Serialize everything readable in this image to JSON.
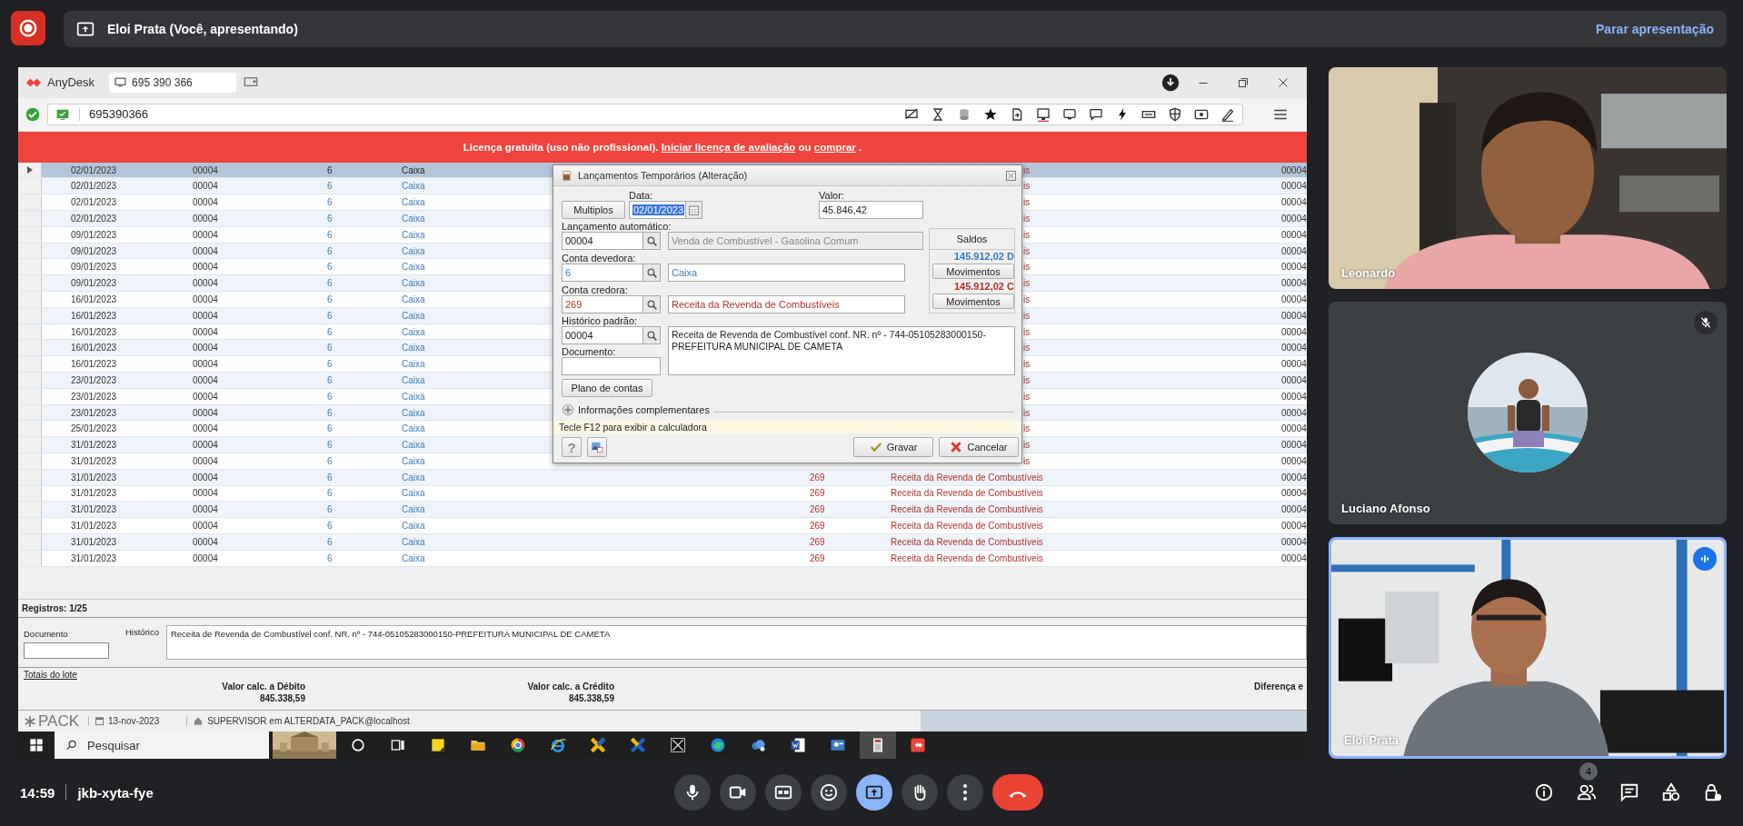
{
  "meet_top": {
    "presenting_label": "Eloi Prata (Você, apresentando)",
    "stop_button": "Parar apresentação"
  },
  "anydesk": {
    "app_name": "AnyDesk",
    "tab_label": "695 390 366",
    "address": "695390366",
    "banner": {
      "text": "Licença gratuita (uso não profissional).",
      "trial_link": "Iniciar licença de avaliação",
      "or": "ou",
      "buy_link": "comprar",
      "end": "."
    }
  },
  "table": {
    "rows": [
      {
        "selected": true,
        "date": "02/01/2023",
        "entry": "00004",
        "debit_code": "6",
        "debit_name": "Caixa",
        "credit_name": "is",
        "column_7": "00004"
      },
      {
        "selected": false,
        "date": "02/01/2023",
        "entry": "00004",
        "debit_code": "6",
        "debit_name": "Caixa",
        "credit_name": "is",
        "column_7": "00004"
      },
      {
        "selected": false,
        "date": "02/01/2023",
        "entry": "00004",
        "debit_code": "6",
        "debit_name": "Caixa",
        "credit_name": "is",
        "column_7": "00004"
      },
      {
        "selected": false,
        "date": "02/01/2023",
        "entry": "00004",
        "debit_code": "6",
        "debit_name": "Caixa",
        "credit_name": "is",
        "column_7": "00004"
      },
      {
        "selected": false,
        "date": "09/01/2023",
        "entry": "00004",
        "debit_code": "6",
        "debit_name": "Caixa",
        "credit_name": "is",
        "column_7": "00004"
      },
      {
        "selected": false,
        "date": "09/01/2023",
        "entry": "00004",
        "debit_code": "6",
        "debit_name": "Caixa",
        "credit_name": "is",
        "column_7": "00004"
      },
      {
        "selected": false,
        "date": "09/01/2023",
        "entry": "00004",
        "debit_code": "6",
        "debit_name": "Caixa",
        "credit_name": "is",
        "column_7": "00004"
      },
      {
        "selected": false,
        "date": "09/01/2023",
        "entry": "00004",
        "debit_code": "6",
        "debit_name": "Caixa",
        "credit_name": "is",
        "column_7": "00004"
      },
      {
        "selected": false,
        "date": "16/01/2023",
        "entry": "00004",
        "debit_code": "6",
        "debit_name": "Caixa",
        "credit_name": "is",
        "column_7": "00004"
      },
      {
        "selected": false,
        "date": "16/01/2023",
        "entry": "00004",
        "debit_code": "6",
        "debit_name": "Caixa",
        "credit_name": "is",
        "column_7": "00004"
      },
      {
        "selected": false,
        "date": "16/01/2023",
        "entry": "00004",
        "debit_code": "6",
        "debit_name": "Caixa",
        "credit_name": "is",
        "column_7": "00004"
      },
      {
        "selected": false,
        "date": "16/01/2023",
        "entry": "00004",
        "debit_code": "6",
        "debit_name": "Caixa",
        "credit_name": "is",
        "column_7": "00004"
      },
      {
        "selected": false,
        "date": "16/01/2023",
        "entry": "00004",
        "debit_code": "6",
        "debit_name": "Caixa",
        "credit_name": "is",
        "column_7": "00004"
      },
      {
        "selected": false,
        "date": "23/01/2023",
        "entry": "00004",
        "debit_code": "6",
        "debit_name": "Caixa",
        "credit_name": "is",
        "column_7": "00004"
      },
      {
        "selected": false,
        "date": "23/01/2023",
        "entry": "00004",
        "debit_code": "6",
        "debit_name": "Caixa",
        "credit_name": "is",
        "column_7": "00004"
      },
      {
        "selected": false,
        "date": "23/01/2023",
        "entry": "00004",
        "debit_code": "6",
        "debit_name": "Caixa",
        "credit_name": "is",
        "column_7": "00004"
      },
      {
        "selected": false,
        "date": "25/01/2023",
        "entry": "00004",
        "debit_code": "6",
        "debit_name": "Caixa",
        "credit_name": "is",
        "column_7": "00004"
      },
      {
        "selected": false,
        "date": "31/01/2023",
        "entry": "00004",
        "debit_code": "6",
        "debit_name": "Caixa",
        "credit_name": "is",
        "column_7": "00004"
      },
      {
        "selected": false,
        "date": "31/01/2023",
        "entry": "00004",
        "debit_code": "6",
        "debit_name": "Caixa",
        "credit_name": "is",
        "column_7": "00004"
      },
      {
        "selected": false,
        "date": "31/01/2023",
        "entry": "00004",
        "debit_code": "6",
        "debit_name": "Caixa",
        "credit_code": "269",
        "credit_name": "Receita da Revenda de Combustíveis",
        "column_7": "00004"
      },
      {
        "selected": false,
        "date": "31/01/2023",
        "entry": "00004",
        "debit_code": "6",
        "debit_name": "Caixa",
        "credit_code": "269",
        "credit_name": "Receita da Revenda de Combustíveis",
        "column_7": "00004"
      },
      {
        "selected": false,
        "date": "31/01/2023",
        "entry": "00004",
        "debit_code": "6",
        "debit_name": "Caixa",
        "credit_code": "269",
        "credit_name": "Receita da Revenda de Combustíveis",
        "column_7": "00004"
      },
      {
        "selected": false,
        "date": "31/01/2023",
        "entry": "00004",
        "debit_code": "6",
        "debit_name": "Caixa",
        "credit_code": "269",
        "credit_name": "Receita da Revenda de Combustíveis",
        "column_7": "00004"
      },
      {
        "selected": false,
        "date": "31/01/2023",
        "entry": "00004",
        "debit_code": "6",
        "debit_name": "Caixa",
        "credit_code": "269",
        "credit_name": "Receita da Revenda de Combustíveis",
        "column_7": "00004"
      },
      {
        "selected": false,
        "date": "31/01/2023",
        "entry": "00004",
        "debit_code": "6",
        "debit_name": "Caixa",
        "credit_code": "269",
        "credit_name": "Receita da Revenda de Combustíveis",
        "column_7": "00004"
      }
    ]
  },
  "records": "Registros: 1/25",
  "details": {
    "document_label": "Documento",
    "history_label": "Histórico",
    "history": "Receita de Revenda de Combustível conf. NR. nº  - 744-05105283000150-PREFEITURA MUNICIPAL DE CAMETA"
  },
  "totals": {
    "title": "Totais do lote",
    "debit_label": "Valor calc. a Débito",
    "debit": "845.338,59",
    "credit_label": "Valor calc. a Crédito",
    "credit": "845.338,59",
    "difference_label": "Diferença e"
  },
  "status_bar": {
    "logo": "PACK",
    "date": "13-nov-2023",
    "user": "SUPERVISOR em ALTERDATA_PACK@localhost"
  },
  "taskbar": {
    "search_placeholder": "Pesquisar",
    "apps": [
      {
        "kind": "circle",
        "active": false
      },
      {
        "kind": "taskview",
        "active": false
      },
      {
        "kind": "note",
        "active": false
      },
      {
        "kind": "folder",
        "active": false
      },
      {
        "kind": "browser",
        "active": false
      },
      {
        "kind": "ie",
        "active": false
      },
      {
        "kind": "xa",
        "active": false
      },
      {
        "kind": "xb",
        "active": false
      },
      {
        "kind": "dark",
        "active": false
      },
      {
        "kind": "edge",
        "active": false
      },
      {
        "kind": "cloud",
        "active": false
      },
      {
        "kind": "word",
        "active": false
      },
      {
        "kind": "card",
        "active": false
      },
      {
        "kind": "calc",
        "active": true
      },
      {
        "kind": "remote",
        "active": false
      }
    ]
  },
  "dialog": {
    "title": "Lançamentos Temporários (Alteração)",
    "multiple_button": "Multiplos",
    "date_label": "Data:",
    "date": "02/01/2023",
    "date_selected": true,
    "value_label": "Valor:",
    "value": "45.846,42",
    "auto_label": "Lançamento automático:",
    "auto_code": "00004",
    "auto_name": "Venda de Combustível - Gasolina Comum",
    "auto_name_disabled": true,
    "balances_label": "Saldos",
    "debit_label": "Conta devedora:",
    "debit_code": "6",
    "debit_name": "Caixa",
    "debit_balance": "145.912,02 D",
    "credit_label": "Conta credora:",
    "credit_code": "269",
    "credit_name": "Receita da Revenda de Combustíveis",
    "credit_balance": "145.912,02 C",
    "movements_buttons": [
      "Movimentos",
      "Movimentos"
    ],
    "history_label": "Histórico padrão:",
    "history_code": "00004",
    "history_text": "Receita de Revenda de Combustível conf. NR. nº  - 744-05105283000150-PREFEITURA MUNICIPAL DE CAMETA",
    "document_label": "Documento:",
    "accounts_button": "Plano de contas",
    "more_info": "Informações complementares",
    "hint": "Tecle F12 para exibir a calculadora",
    "help_button": "?",
    "save_button": "Gravar",
    "cancel_button": "Cancelar"
  },
  "participants": [
    {
      "name": "Leonardo",
      "kind": "video",
      "muted": false,
      "speaking": false
    },
    {
      "name": "Luciano Afonso",
      "kind": "avatar",
      "muted": true,
      "speaking": false
    },
    {
      "name": "Eloi Prata",
      "kind": "video",
      "muted": false,
      "speaking": true
    }
  ],
  "meeting": {
    "time": "14:59",
    "code": "jkb-xyta-fye",
    "people_count": "4"
  },
  "controls": [
    {
      "kind": "mic",
      "active": false
    },
    {
      "kind": "camera",
      "active": false
    },
    {
      "kind": "captions",
      "active": false
    },
    {
      "kind": "emoji",
      "active": false
    },
    {
      "kind": "present",
      "active": true
    },
    {
      "kind": "hand",
      "active": false
    },
    {
      "kind": "more",
      "active": false
    },
    {
      "kind": "end"
    }
  ]
}
